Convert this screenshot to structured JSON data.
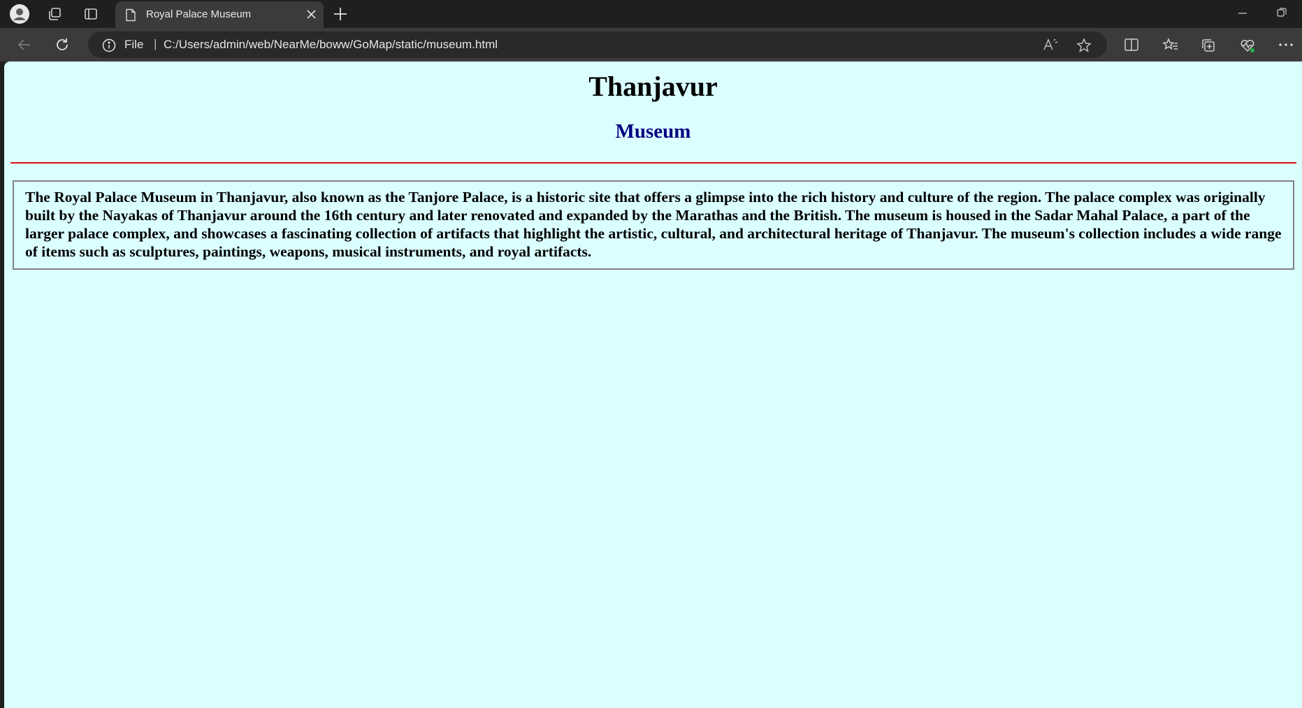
{
  "browser": {
    "tab": {
      "title": "Royal Palace Museum"
    },
    "addressbar": {
      "scheme_label": "File",
      "separator": "|",
      "url": "C:/Users/admin/web/NearMe/boww/GoMap/static/museum.html"
    },
    "colors": {
      "chrome_dark": "#1f1f1f",
      "toolbar": "#3b3b3b",
      "address_bg": "#292929"
    }
  },
  "page": {
    "heading": "Thanjavur",
    "subheading": "Museum",
    "description": "The Royal Palace Museum in Thanjavur, also known as the Tanjore Palace, is a historic site that offers a glimpse into the rich history and culture of the region. The palace complex was originally built by the Nayakas of Thanjavur around the 16th century and later renovated and expanded by the Marathas and the British. The museum is housed in the Sadar Mahal Palace, a part of the larger palace complex, and showcases a fascinating collection of artifacts that highlight the artistic, cultural, and architectural heritage of Thanjavur. The museum's collection includes a wide range of items such as sculptures, paintings, weapons, musical instruments, and royal artifacts.",
    "colors": {
      "background": "#dbffff",
      "subheading": "#000080",
      "rule": "#e01010"
    }
  },
  "icons": [
    "profile-icon",
    "workspaces-icon",
    "vertical-tabs-icon",
    "document-icon",
    "close-icon",
    "new-tab-icon",
    "minimize-icon",
    "restore-icon",
    "back-icon",
    "refresh-icon",
    "info-icon",
    "read-aloud-icon",
    "favorite-star-icon",
    "split-screen-icon",
    "favorites-icon",
    "collections-icon",
    "browser-essentials-icon",
    "more-icon"
  ]
}
